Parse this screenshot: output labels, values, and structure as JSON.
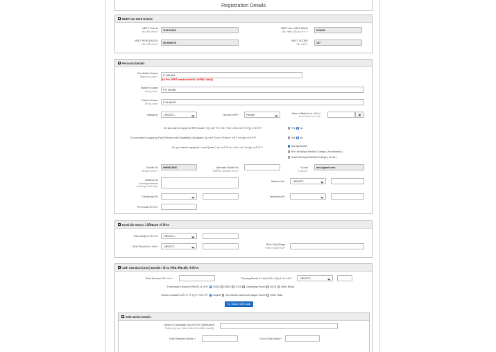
{
  "page_title": "Registration Details",
  "neet": {
    "heading": "NEET UG 2020 Details",
    "roll_label": "NEET Roll No",
    "roll_sub": "નીટ રોલ નંબર:*",
    "roll_value": "1101XX003",
    "air_label": "NEET ALL INDIA RANK",
    "air_sub": "નીટ ઓલ ઇન્ડિયા રેન્ક :*",
    "air_value": "XX6402",
    "percentile_label": "NEET PERCENTILE",
    "percentile_sub": "નીટ પર્સેન્ટાઇલ*",
    "percentile_value": "56.9849478",
    "score_label": "NEET SCORE",
    "score_sub": "નીટ સ્કોર:*",
    "score_value": "157"
  },
  "personal": {
    "heading": "Personal Details",
    "name_label": "Candidate's Name",
    "name_sub": "ઉમેદવારનું નામ: *",
    "name_value": "E VISHAM",
    "name_note": "(As Per NEET marksheet/નીટ માર્કશીટ પ્રમાણે)",
    "mother_label": "Mother's Name",
    "mother_sub": "માતાનું નામ:*",
    "mother_value": "P K GOURI",
    "father_label": "Father's Name",
    "father_sub": "પિતાનું નામ:*",
    "father_value": "R ELANGO",
    "category_label": "Category*",
    "category_value": "--SELECT--",
    "gender_label": "Gender/જાતિ*",
    "gender_value": "Female",
    "dob_label": "Date of Birth/જન્મ તારીખ*",
    "dob_note": "(as per SSC/માર્કશીટ પ્રમાણે)",
    "nri_q": "Do you want to apply for NRI Quota ? શું તમારે એન.આર.આઈ કવોટા માટે અરજી કરવી છે?*",
    "pwd_q": "Do you want to apply as PwD (Person with Disability) Candidate? શું તમારે દિવ્યાંગ ઉમેદવાર તરીકે અરજી કરવી છે?*",
    "local_q": "Do you want to apply for Local Quota ? શું તમારે લોકલ કવોટા માટે અરજી કરવી છે?*",
    "yes": "Yes",
    "no": "No",
    "local_opts": [
      "Not Applicable",
      "NHL Municipal Medical College ( Ahmedabad )",
      "Surat Municipal Medical College ( Surat )"
    ],
    "mobile_label": "Mobile No",
    "mobile_sub": "મોબાઇલ નંબર:*",
    "mobile_value": "9899874536",
    "alt_label": "Alternate Mobile No",
    "alt_sub": "વૈકલ્પિક મોબાઇલ નંબર:*",
    "email_label": "E-mail",
    "email_sub": "ઇ-મેઇલ:*",
    "email_value": "abc@gmail.com",
    "address_label": "Address for",
    "address_label2": "correspondence/",
    "address_sub": "પત્રવ્યવહાર સરનામું:*",
    "state_label": "State/રાજ્ય*",
    "state_value": "--SELECT--",
    "district_label": "District/જીલ્લો*",
    "taluka_label": "Taluka/તાલુકો*",
    "pin_label": "PIN Code/પીનકોડ*"
  },
  "domicile": {
    "heading": "Domicile Status / ડોમિસાઇલ ની વિગત",
    "citizenship_label": "Citizenship/નાગરિકતા*",
    "citizenship_value": "--SELECT--",
    "birthplace_label": "Birth Place/જન્મ સ્થળ*",
    "birthplace_value": "--SELECT--",
    "birthcity_label": "Birth City/Village",
    "birthcity_sub": "જન્મ નું શહેર/ગામ*"
  },
  "ssc": {
    "heading": "10th Standard (SSC) Details / ધો.૧૦ (એસ.એસ.સી) ની વિગત",
    "seat_label": "Seat Number/સીટ નંબર:*",
    "passing_label": "Passing Month & Year/પાસિંગ મહિનો અને વર્ષ *",
    "passing_value": "--SELECT--",
    "board_label": "Examination Board/પરીક્ષાબોર્ડ નું નામ*",
    "boards": [
      "GSEB",
      "CBSE",
      "ICSE",
      "Cambridge Board",
      "NIOS",
      "Other Board"
    ],
    "school_label": "School Located in/ધો.૧૦ ની સ્કૂલ આવેલ છે*",
    "locations": [
      "Gujarat",
      "Diu,Daman,Dadra and Nagar Haveli",
      "Other State"
    ],
    "search_btn": "Search 10th Data",
    "marks_heading": "10th Marks Details",
    "cand_label": "Name of Candidate (As per SSC Marksheet)",
    "cand_sub": "ઉમેદવારનું નામ (એસ.એસ.સી માર્કશીટ પ્રમાણે)*",
    "obtained_label": "Total Obtained Marks :*",
    "outof_label": "Out of Total Marks:*"
  }
}
